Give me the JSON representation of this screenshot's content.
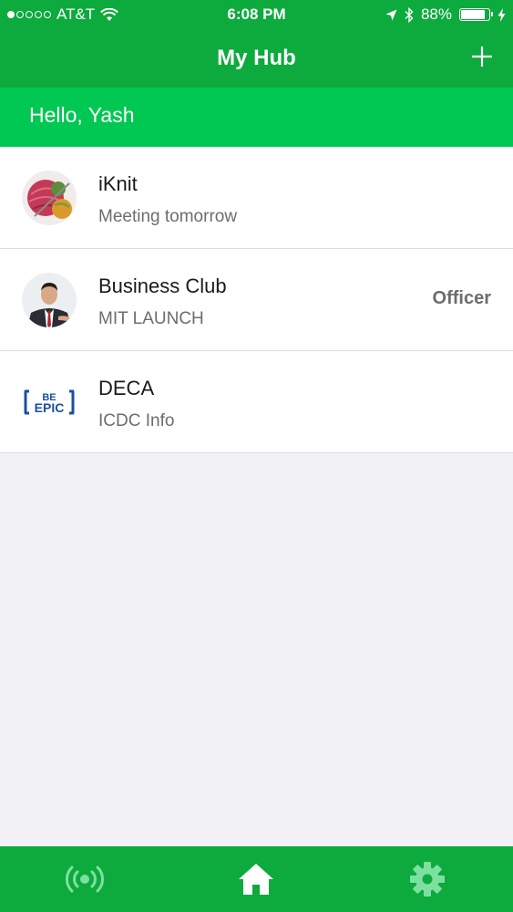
{
  "status_bar": {
    "carrier": "AT&T",
    "time": "6:08 PM",
    "battery": "88%",
    "battery_level": 0.88,
    "signal_bars_filled": 1,
    "signal_bars_total": 5
  },
  "header": {
    "title": "My Hub",
    "add_icon": "plus-icon"
  },
  "greeting": "Hello, Yash",
  "groups": [
    {
      "name": "iKnit",
      "subtitle": "Meeting tomorrow",
      "badge": "",
      "avatar_icon": "yarn-avatar"
    },
    {
      "name": "Business Club",
      "subtitle": "MIT LAUNCH",
      "badge": "Officer",
      "avatar_icon": "businessman-avatar"
    },
    {
      "name": "DECA",
      "subtitle": "ICDC Info",
      "badge": "",
      "avatar_icon": "be-epic-logo",
      "logo_text_top": "BE",
      "logo_text_bottom": "EPIC"
    }
  ],
  "tab_bar": {
    "tabs": [
      {
        "icon": "broadcast-icon",
        "active": false
      },
      {
        "icon": "home-icon",
        "active": true
      },
      {
        "icon": "gear-icon",
        "active": false
      }
    ]
  },
  "colors": {
    "header_green": "#0daa3d",
    "greeting_green": "#00c853",
    "inactive_tab": "#7ee0a0"
  }
}
